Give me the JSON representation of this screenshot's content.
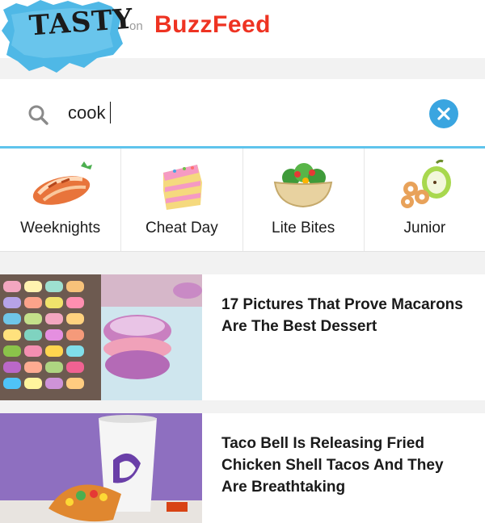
{
  "header": {
    "logo_text": "TASTY",
    "on_label": "on",
    "brand_label": "BuzzFeed"
  },
  "search": {
    "value": "cook",
    "icon": "search-icon",
    "clear_icon": "close-icon"
  },
  "categories": [
    {
      "label": "Weeknights",
      "icon": "chicken-breast-icon"
    },
    {
      "label": "Cheat Day",
      "icon": "cake-slice-icon"
    },
    {
      "label": "Lite Bites",
      "icon": "salad-bowl-icon"
    },
    {
      "label": "Junior",
      "icon": "apple-snack-icon"
    }
  ],
  "articles": [
    {
      "title": "17 Pictures That Prove Macarons Are The Best Dessert",
      "thumb": "macarons-image"
    },
    {
      "title": "Taco Bell Is Releasing Fried Chicken Shell Tacos And They Are Breathtaking",
      "thumb": "taco-image"
    }
  ],
  "colors": {
    "brand_red": "#ee3322",
    "accent_blue": "#5fc4ec",
    "clear_blue": "#3aa5e0",
    "logo_blue": "#4fb8e6"
  }
}
